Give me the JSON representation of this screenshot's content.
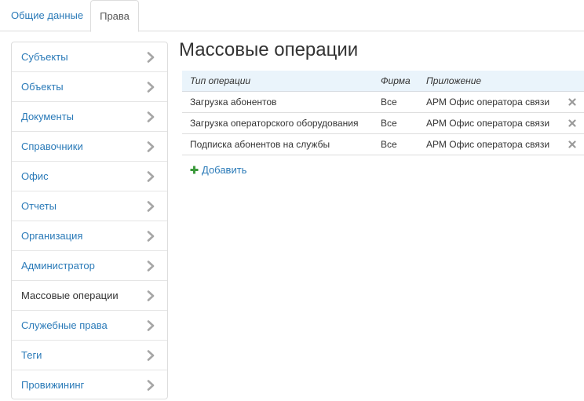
{
  "tabs": {
    "general": "Общие данные",
    "rights": "Права"
  },
  "sidebar": {
    "items": [
      {
        "label": "Субъекты",
        "active": false
      },
      {
        "label": "Объекты",
        "active": false
      },
      {
        "label": "Документы",
        "active": false
      },
      {
        "label": "Справочники",
        "active": false
      },
      {
        "label": "Офис",
        "active": false
      },
      {
        "label": "Отчеты",
        "active": false
      },
      {
        "label": "Организация",
        "active": false
      },
      {
        "label": "Администратор",
        "active": false
      },
      {
        "label": "Массовые операции",
        "active": true
      },
      {
        "label": "Служебные права",
        "active": false
      },
      {
        "label": "Теги",
        "active": false
      },
      {
        "label": "Провижининг",
        "active": false
      }
    ]
  },
  "main": {
    "title": "Массовые операции",
    "table": {
      "headers": {
        "type": "Тип операции",
        "firm": "Фирма",
        "app": "Приложение"
      },
      "rows": [
        {
          "type": "Загрузка абонентов",
          "firm": "Все",
          "app": "АРМ Офис оператора связи"
        },
        {
          "type": "Загрузка операторского оборудования",
          "firm": "Все",
          "app": "АРМ Офис оператора связи"
        },
        {
          "type": "Подписка абонентов на службы",
          "firm": "Все",
          "app": "АРМ Офис оператора связи"
        }
      ]
    },
    "add_label": "Добавить"
  },
  "colors": {
    "link": "#2a7ab8",
    "header_bg": "#eaf4fb",
    "add_icon": "#3c9a3c",
    "delete_icon": "#9a9a9a",
    "chevron": "#a6a6a6"
  },
  "icons": {
    "chevron": "chevron-right-icon",
    "delete": "close-icon",
    "add": "plus-icon"
  }
}
